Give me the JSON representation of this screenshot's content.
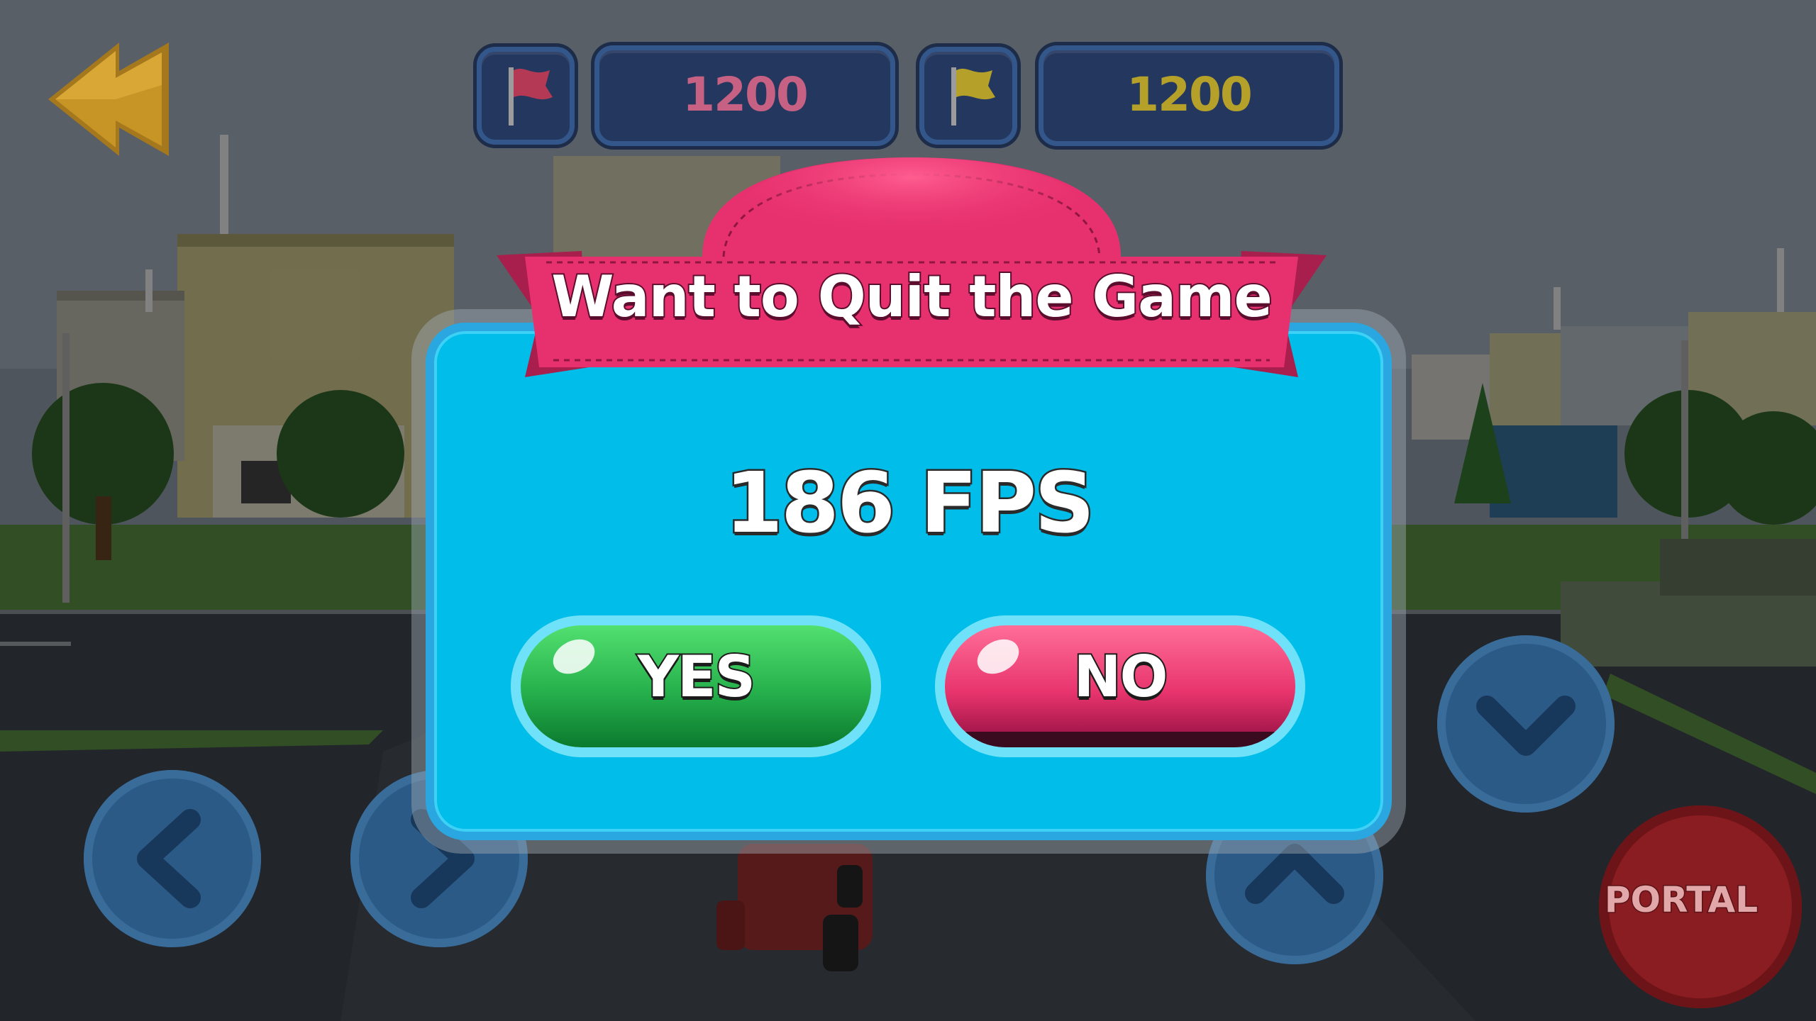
{
  "hud": {
    "score_red": "1200",
    "score_yellow": "1200",
    "colors": {
      "red": "#c66184",
      "yellow": "#b5a12a"
    },
    "icons": [
      "back-arrow-icon",
      "red-flag-icon",
      "yellow-flag-icon"
    ]
  },
  "dialog": {
    "title": "Want to Quit the Game",
    "fps": "186 FPS",
    "yes_label": "YES",
    "no_label": "NO",
    "colors": {
      "panel": "#00bde9",
      "banner": "#e7316f",
      "yes": "#26b04c",
      "no": "#e8346d"
    }
  },
  "controls": {
    "portal_label": "PORTAL",
    "icons": [
      "left-arrow-icon",
      "right-arrow-icon",
      "up-arrow-icon",
      "down-arrow-icon"
    ]
  }
}
